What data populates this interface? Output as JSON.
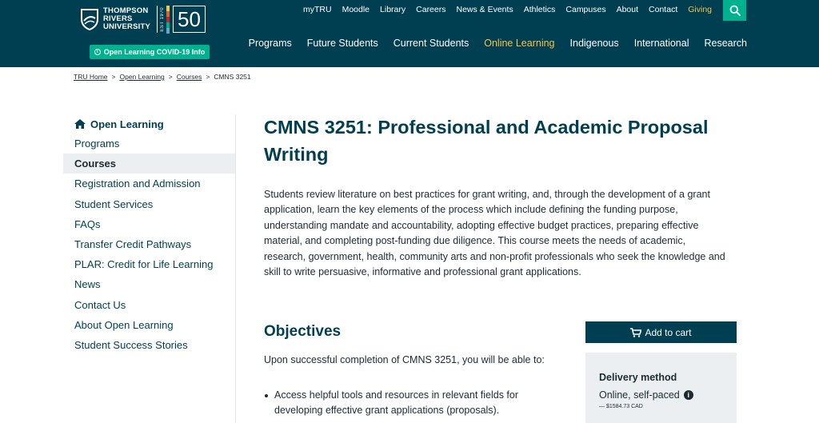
{
  "header": {
    "logo_line1": "THOMPSON",
    "logo_line2": "RIVERS",
    "logo_line3": "UNIVERSITY",
    "logo_est": "EST 1970",
    "logo_anniversary": "50",
    "covid_button": "Open Learning COVID-19 Info",
    "util_nav": [
      "myTRU",
      "Moodle",
      "Library",
      "Careers",
      "News & Events",
      "Athletics",
      "Campuses",
      "About",
      "Contact",
      "Giving"
    ],
    "main_nav": [
      "Programs",
      "Future Students",
      "Current Students",
      "Online Learning",
      "Indigenous",
      "International",
      "Research"
    ],
    "active_main_nav": "Online Learning",
    "search_icon": "search-icon",
    "colors": {
      "bg": "#003e51",
      "accent": "#00b18f",
      "highlight": "#f4c44a"
    }
  },
  "breadcrumb": [
    "TRU Home",
    "Open Learning",
    "Courses",
    "CMNS 3251"
  ],
  "sidebar": {
    "heading": "Open Learning",
    "heading_icon": "home-icon",
    "items": [
      "Programs",
      "Courses",
      "Registration and Admission",
      "Student Services",
      "FAQs",
      "Transfer Credit Pathways",
      "PLAR: Credit for Life Learning",
      "News",
      "Contact Us",
      "About Open Learning",
      "Student Success Stories"
    ],
    "active_item": "Courses"
  },
  "main": {
    "title": "CMNS 3251: Professional and Academic Proposal Writing",
    "intro": "Students review literature on best practices for grant writing, and, through the development of a grant application, learn the key elements of the process which include defining the funding purpose, understanding mandate and accountability, adopting effective budget practices, preparing effective material, and completing post-funding due diligence. This course meets the needs of academic, research, government, health, community arts and non-profit professionals who seek the knowledge and skill to write persuasive, informative and professional grant applications.",
    "objectives_heading": "Objectives",
    "objectives_intro": "Upon successful completion of CMNS 3251, you will be able to:",
    "objectives": [
      "Access helpful tools and resources in relevant fields for developing effective grant applications (proposals)."
    ]
  },
  "cart": {
    "button_label": "Add to cart",
    "cart_icon": "cart-icon",
    "delivery_label": "Delivery method",
    "delivery_value": "Online, self-paced",
    "price": "— $1584.73 CAD"
  }
}
